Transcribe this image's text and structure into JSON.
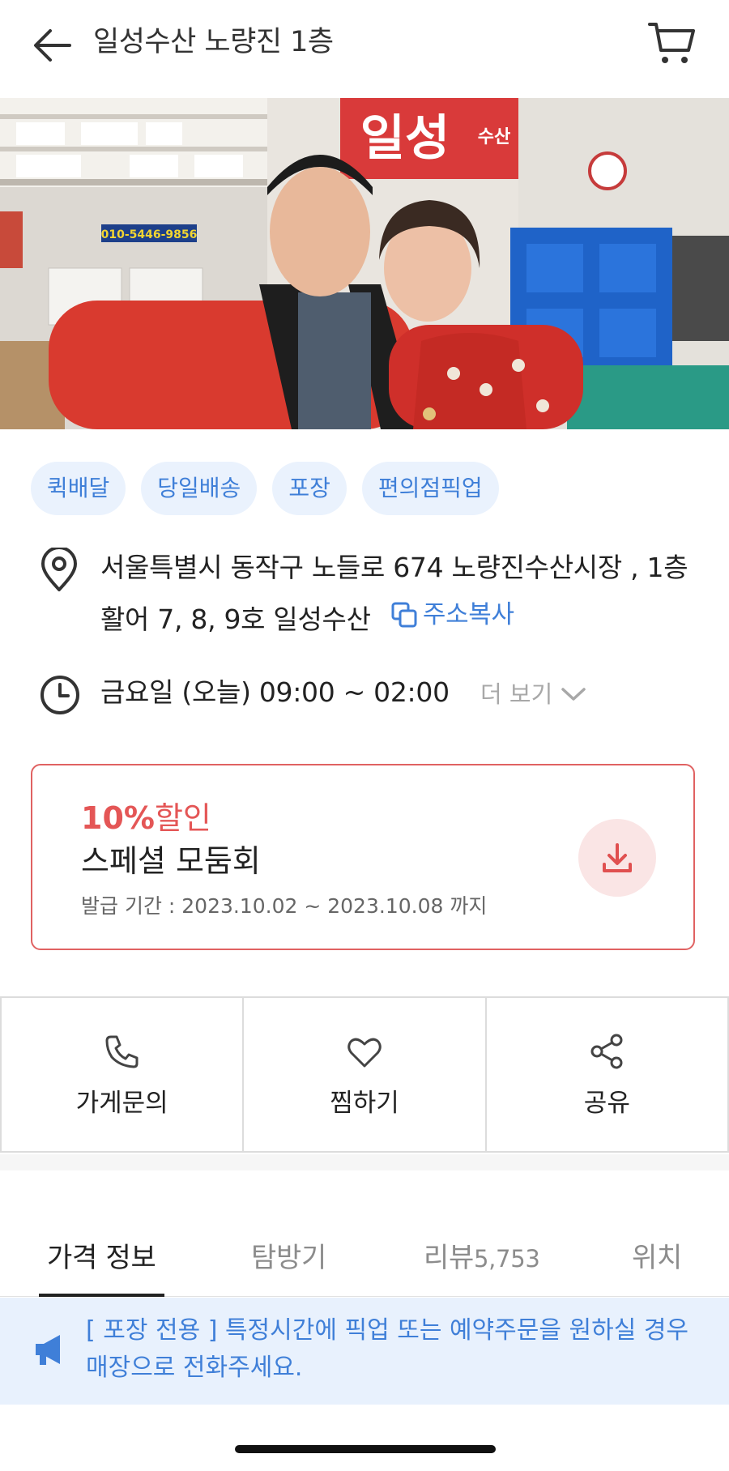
{
  "header": {
    "title": "일성수산 노량진 1층",
    "back_icon": "arrow-left-icon",
    "cart_icon": "cart-icon"
  },
  "hero": {
    "phone_sign": "010-5446-9856",
    "store_sign": "일성",
    "store_sign_small": "수산"
  },
  "tags": [
    "퀵배달",
    "당일배송",
    "포장",
    "편의점픽업"
  ],
  "address": {
    "line": "서울특별시 동작구 노들로 674 노량진수산시장 , 1층 활어 7, 8, 9호 일성수산",
    "copy_label": "주소복사"
  },
  "hours": {
    "text": "금요일 (오늘) 09:00 ~ 02:00",
    "more_label": "더 보기"
  },
  "coupon": {
    "discount_value": "10%",
    "discount_word": "할인",
    "name": "스페셜 모둠회",
    "period": "발급 기간 : 2023.10.02 ~ 2023.10.08 까지",
    "accent_color": "#e45656"
  },
  "actions": [
    {
      "label": "가게문의",
      "icon": "phone-icon"
    },
    {
      "label": "찜하기",
      "icon": "heart-icon"
    },
    {
      "label": "공유",
      "icon": "share-icon"
    }
  ],
  "tabs": {
    "price": "가격 정보",
    "visit": "탐방기",
    "review": "리뷰",
    "review_count": "5,753",
    "location": "위치"
  },
  "notice": {
    "text": "[ 포장 전용 ] 특정시간에 픽업 또는 예약주문을 원하실 경우 매장으로 전화주세요."
  },
  "colors": {
    "accent_blue": "#3f7fd8",
    "tag_bg": "#eaf2fd",
    "notice_bg": "#e8f1fd"
  }
}
